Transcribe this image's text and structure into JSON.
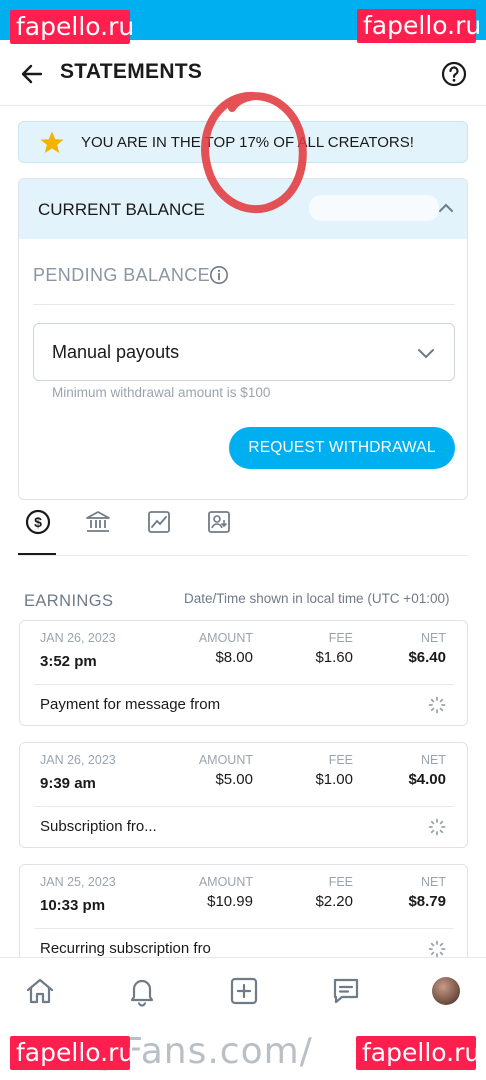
{
  "watermarks": {
    "top_left": "fapello.ru",
    "top_right": "fapello.ru",
    "bottom_left": "fapello.ru",
    "bottom_right": "fapello.ru"
  },
  "header": {
    "title": "STATEMENTS"
  },
  "rank_banner": {
    "text": "YOU ARE IN THE TOP 17% OF ALL CREATORS!"
  },
  "balance": {
    "current_label": "CURRENT BALANCE",
    "pending_label": "PENDING BALANCE",
    "payout_method": "Manual payouts",
    "min_withdrawal": "Minimum withdrawal amount is $100",
    "withdraw_button": "REQUEST WITHDRAWAL"
  },
  "tabs": [
    {
      "icon": "dollar-circle-icon"
    },
    {
      "icon": "bank-icon"
    },
    {
      "icon": "chart-icon"
    },
    {
      "icon": "payout-request-icon"
    }
  ],
  "earnings": {
    "title": "EARNINGS",
    "timezone_note": "Date/Time shown in local time (UTC +01:00)",
    "col_amount": "AMOUNT",
    "col_fee": "FEE",
    "col_net": "NET",
    "rows": [
      {
        "date": "JAN 26, 2023",
        "time": "3:52 pm",
        "amount": "$8.00",
        "fee": "$1.60",
        "net": "$6.40",
        "description": "Payment for message from"
      },
      {
        "date": "JAN 26, 2023",
        "time": "9:39 am",
        "amount": "$5.00",
        "fee": "$1.00",
        "net": "$4.00",
        "description": "Subscription fro..."
      },
      {
        "date": "JAN 25, 2023",
        "time": "10:33 pm",
        "amount": "$10.99",
        "fee": "$2.20",
        "net": "$8.79",
        "description": "Recurring subscription fro"
      }
    ]
  },
  "bottom_nav": {
    "items": [
      "home-icon",
      "bell-icon",
      "add-post-icon",
      "messages-icon",
      "avatar"
    ]
  },
  "footer": {
    "partial_text": "yFans.com/"
  },
  "colors": {
    "accent": "#00aff0",
    "watermark": "#ff1f4f",
    "banner_bg": "#e3f3fb",
    "annotation": "#e03a3e",
    "star": "#f5b301"
  }
}
